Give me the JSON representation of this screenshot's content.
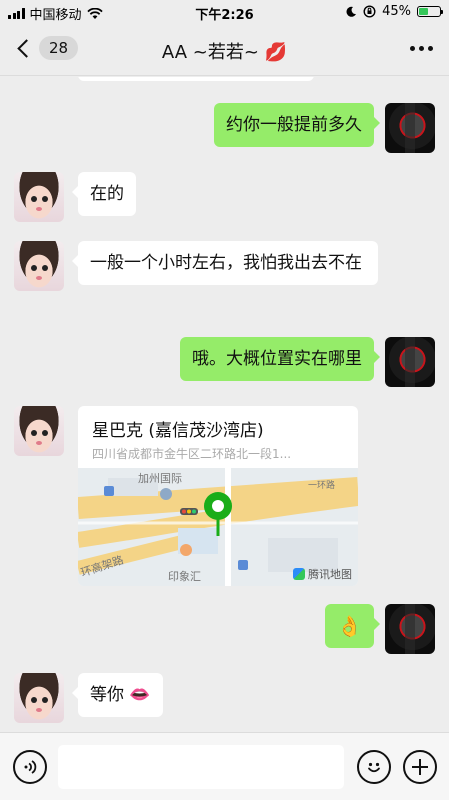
{
  "status_bar": {
    "carrier": "中国移动",
    "time": "下午2:26",
    "battery_percent": "45%",
    "battery_level": 0.45
  },
  "nav": {
    "unread_count": "28",
    "title": "AA ~若若~ 💋"
  },
  "messages": [
    {
      "side": "out",
      "type": "text",
      "text": "约你一般提前多久"
    },
    {
      "side": "in",
      "type": "text",
      "text": "在的"
    },
    {
      "side": "in",
      "type": "text",
      "text": "一般一个小时左右，我怕我出去不在"
    },
    {
      "side": "out",
      "type": "text",
      "text": "哦。大概位置实在哪里"
    },
    {
      "side": "in",
      "type": "location",
      "name": "星巴克 (嘉信茂沙湾店)",
      "address": "四川省成都市金牛区二环路北一段1...",
      "map_labels": [
        "加州国际",
        "环高架路",
        "印象汇",
        "一环路"
      ],
      "map_brand": "腾讯地图"
    },
    {
      "side": "out",
      "type": "text",
      "text": "👌"
    },
    {
      "side": "in",
      "type": "text",
      "text": "等你 👄"
    }
  ],
  "colors": {
    "outgoing_bubble": "#95ec69",
    "incoming_bubble": "#ffffff",
    "background": "#ededed",
    "map_pin": "#1aad19"
  },
  "icons": {
    "back": "chevron-left-icon",
    "more": "more-dots-icon",
    "voice": "voice-icon",
    "emoji": "emoji-icon",
    "plus": "plus-icon"
  }
}
